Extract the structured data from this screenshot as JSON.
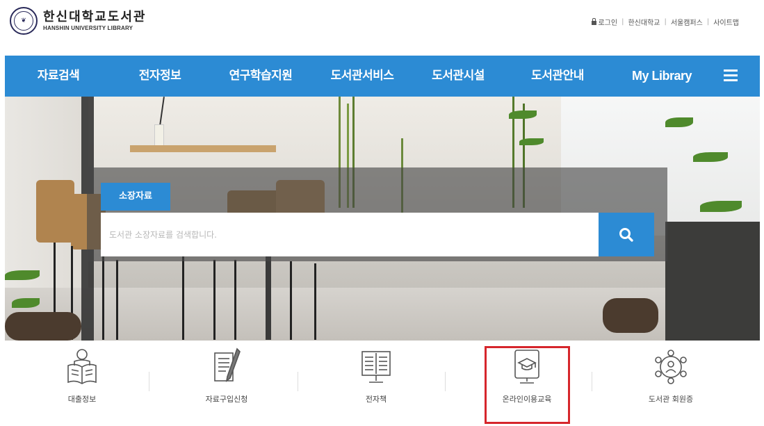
{
  "header": {
    "logo_ko": "한신대학교도서관",
    "logo_en": "HANSHIN UNIVERSITY LIBRARY",
    "utility_links": [
      "로그인",
      "한신대학교",
      "서울캠퍼스",
      "사이트맵"
    ]
  },
  "nav": {
    "items": [
      "자료검색",
      "전자정보",
      "연구학습지원",
      "도서관서비스",
      "도서관시설",
      "도서관안내",
      "My Library"
    ],
    "menu_icon": "hamburger-menu-icon",
    "color": "#2c8bd4"
  },
  "search": {
    "tab_label": "소장자료",
    "placeholder": "도서관 소장자료를 검색합니다.",
    "button_icon": "search-icon"
  },
  "quick_links": [
    {
      "label": "대출정보",
      "icon": "reading-person-icon"
    },
    {
      "label": "자료구입신청",
      "icon": "document-pen-icon"
    },
    {
      "label": "전자책",
      "icon": "ebook-monitor-icon"
    },
    {
      "label": "온라인이용교육",
      "icon": "online-education-icon"
    },
    {
      "label": "도서관 회원증",
      "icon": "member-card-network-icon"
    }
  ],
  "highlight_color": "#d6262c"
}
